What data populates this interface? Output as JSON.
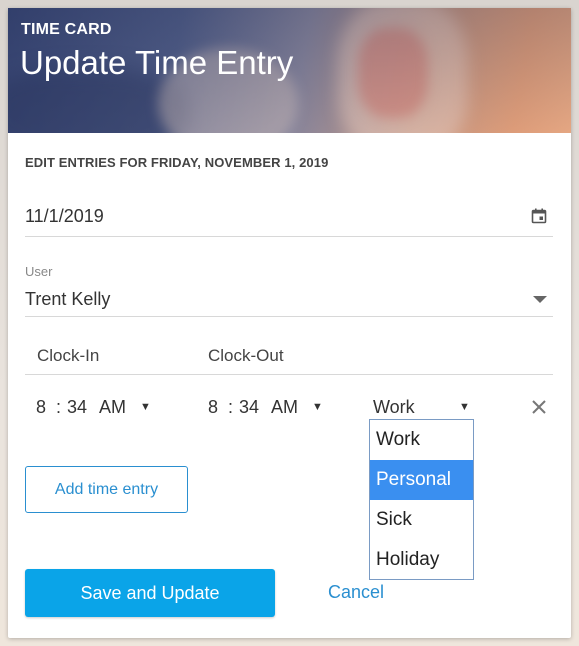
{
  "header": {
    "eyebrow": "TIME CARD",
    "title": "Update Time Entry"
  },
  "form": {
    "section_heading": "EDIT ENTRIES FOR FRIDAY, NOVEMBER 1, 2019",
    "date_value": "11/1/2019",
    "date_icon": "calendar-icon",
    "user_label": "User",
    "user_value": "Trent Kelly",
    "clock_in_header": "Clock-In",
    "clock_out_header": "Clock-Out"
  },
  "entry": {
    "clock_in": {
      "hour": "8",
      "sep": ":",
      "minute": "34",
      "ampm": "AM",
      "arrow": "▼"
    },
    "clock_out": {
      "hour": "8",
      "sep": ":",
      "minute": "34",
      "ampm": "AM",
      "arrow": "▼"
    },
    "type_value": "Work",
    "type_arrow": "▼",
    "remove_icon": "close-icon"
  },
  "type_dropdown": {
    "options": [
      "Work",
      "Personal",
      "Sick",
      "Holiday"
    ],
    "highlighted": "Personal"
  },
  "buttons": {
    "add_entry": "Add time entry",
    "save": "Save and Update",
    "cancel": "Cancel"
  },
  "colors": {
    "accent": "#0aa4e8",
    "link": "#2a8fd0",
    "highlight": "#3a8ff0"
  }
}
